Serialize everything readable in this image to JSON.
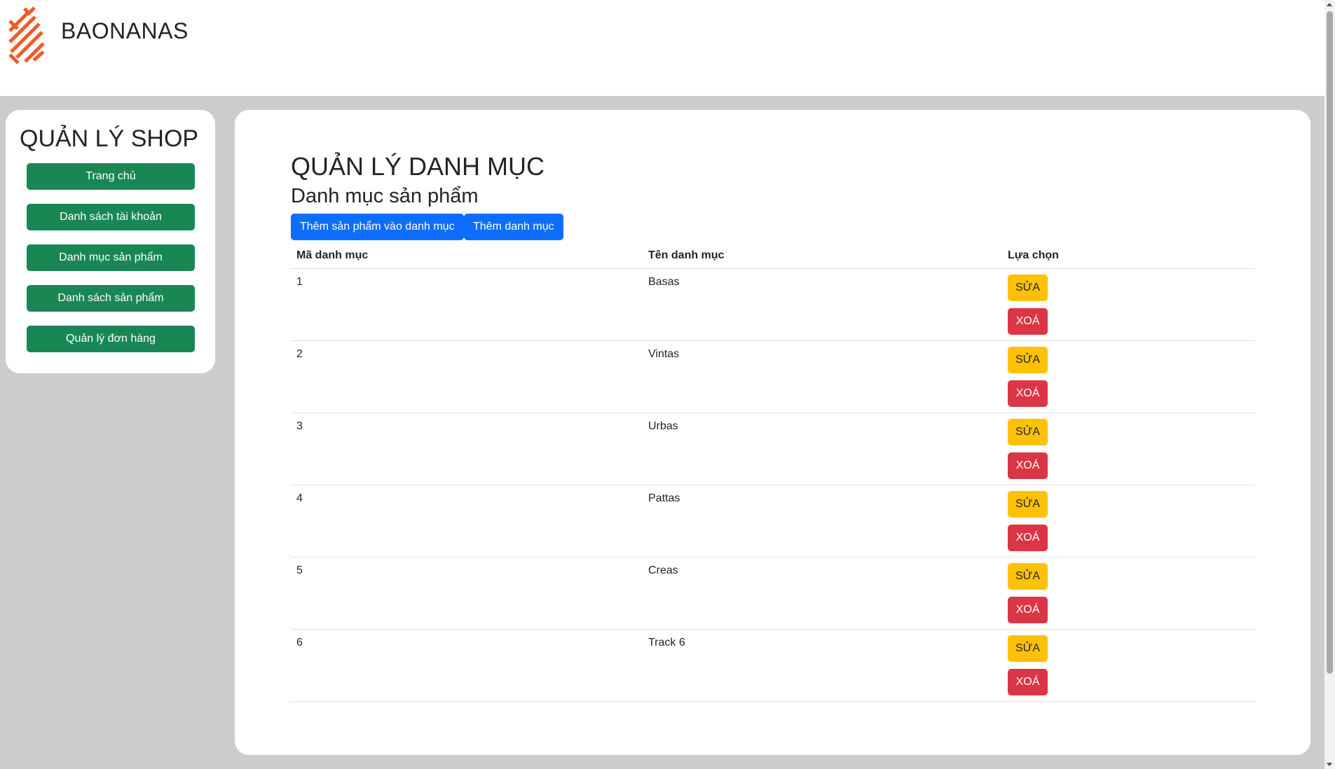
{
  "header": {
    "brand": "BAONANAS",
    "logo": "baonanas-logo"
  },
  "sidebar": {
    "title": "QUẢN LÝ SHOP",
    "items": [
      {
        "label": "Trang chủ"
      },
      {
        "label": "Danh sách tài khoản"
      },
      {
        "label": "Danh mục sản phẩm"
      },
      {
        "label": "Danh sách sản phẩm"
      },
      {
        "label": "Quản lý đơn hàng"
      }
    ]
  },
  "main": {
    "title": "QUẢN LÝ DANH MỤC",
    "subtitle": "Danh mục sản phẩm",
    "add_product_to_category": "Thêm sản phẩm vào danh mục",
    "add_category": "Thêm danh mục",
    "columns": [
      "Mã danh mục",
      "Tên danh mục",
      "Lựa chọn"
    ],
    "rows": [
      {
        "id": "1",
        "name": "Basas"
      },
      {
        "id": "2",
        "name": "Vintas"
      },
      {
        "id": "3",
        "name": "Urbas"
      },
      {
        "id": "4",
        "name": "Pattas"
      },
      {
        "id": "5",
        "name": "Creas"
      },
      {
        "id": "6",
        "name": "Track 6"
      }
    ],
    "edit_label": "SỬA",
    "delete_label": "XOÁ"
  },
  "colors": {
    "sidebar_button": "#198754",
    "primary_button": "#0d6efd",
    "edit_button": "#ffc107",
    "delete_button": "#dc3545",
    "logo": "#f05a28",
    "background": "#cccccc"
  }
}
